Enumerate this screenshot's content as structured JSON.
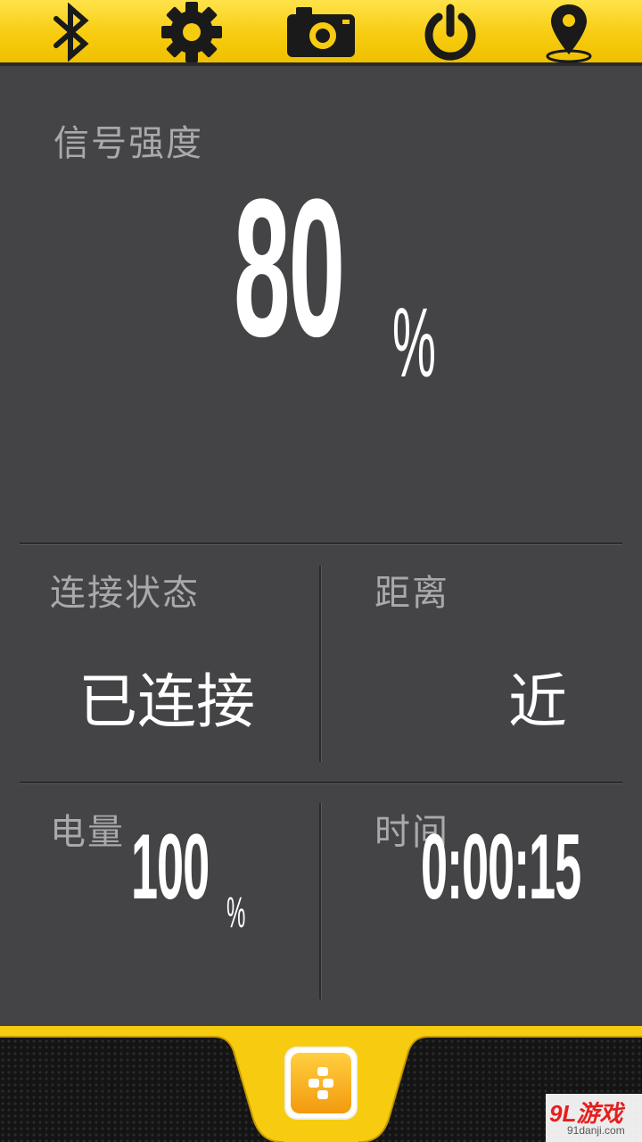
{
  "toolbar": {
    "icons": [
      "bluetooth-icon",
      "gear-icon",
      "camera-icon",
      "power-icon",
      "location-pin-icon"
    ]
  },
  "signal": {
    "label": "信号强度",
    "value": "80",
    "unit": "%"
  },
  "connection": {
    "label": "连接状态",
    "value": "已连接"
  },
  "distance": {
    "label": "距离",
    "value": "近"
  },
  "battery": {
    "label": "电量",
    "value": "100",
    "unit": "%"
  },
  "time": {
    "label": "时间",
    "value": "0:00:15"
  },
  "watermark": {
    "main": "9L游戏",
    "sub": "91danji.com"
  },
  "colors": {
    "accent": "#f7cc10",
    "panel": "#444446",
    "label": "#a9a9ab",
    "value": "#ffffff"
  }
}
